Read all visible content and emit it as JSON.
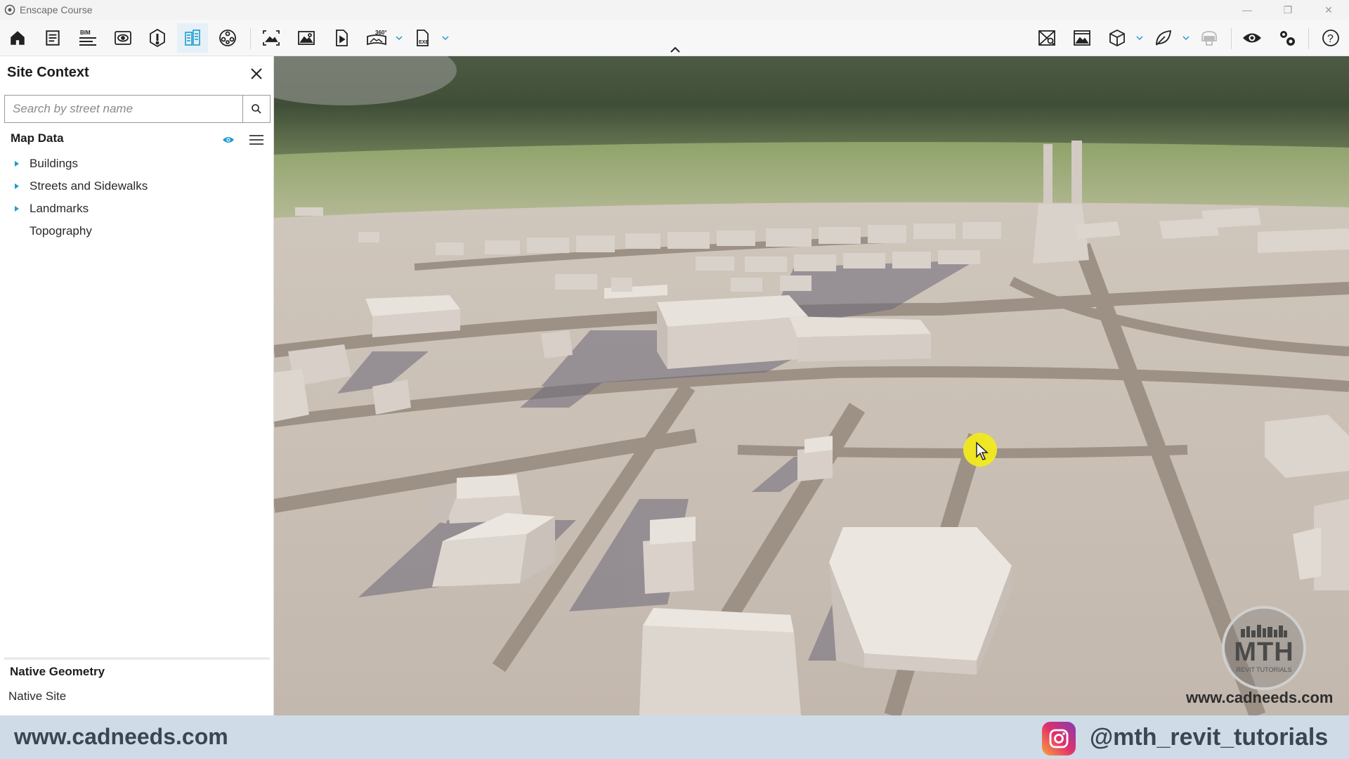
{
  "window": {
    "title": "Enscape Course",
    "controls": [
      "minimize",
      "restore",
      "close"
    ]
  },
  "toolbar": {
    "left_buttons": [
      {
        "name": "home-icon"
      },
      {
        "name": "properties-icon"
      },
      {
        "name": "bim-icon",
        "label": "BIM"
      },
      {
        "name": "view-management-icon"
      },
      {
        "name": "materials-icon"
      },
      {
        "name": "site-context-icon",
        "active": true
      },
      {
        "name": "asset-library-icon"
      },
      {
        "name": "screenshot-icon"
      },
      {
        "name": "batch-render-icon"
      },
      {
        "name": "video-icon"
      },
      {
        "name": "panorama-360-icon",
        "label": "360°"
      },
      {
        "name": "export-exe-icon",
        "label": "EXE"
      }
    ],
    "right_buttons": [
      {
        "name": "map-icon"
      },
      {
        "name": "image-icon"
      },
      {
        "name": "cube-icon"
      },
      {
        "name": "leaf-icon"
      },
      {
        "name": "vr-headset-icon"
      },
      {
        "name": "eye-icon"
      },
      {
        "name": "settings-icon"
      },
      {
        "name": "help-icon"
      }
    ]
  },
  "panel": {
    "title": "Site Context",
    "search": {
      "placeholder": "Search by street name",
      "value": ""
    },
    "map_data": {
      "title": "Map Data",
      "items": [
        {
          "label": "Buildings",
          "expandable": true
        },
        {
          "label": "Streets and Sidewalks",
          "expandable": true
        },
        {
          "label": "Landmarks",
          "expandable": true
        },
        {
          "label": "Topography",
          "expandable": false
        }
      ]
    },
    "native_geometry": {
      "title": "Native Geometry",
      "items": [
        "Native Site"
      ]
    }
  },
  "watermark": {
    "logo_text": "MTH",
    "logo_subtext": "REVIT TUTORIALS",
    "url": "www.cadneeds.com"
  },
  "footer": {
    "url": "www.cadneeds.com",
    "instagram_handle": "@mth_revit_tutorials"
  },
  "colors": {
    "accent": "#1d9bd1",
    "ground": "#c9bfb5",
    "street": "#9a8e84",
    "footer_bg": "#cfdbe7"
  }
}
